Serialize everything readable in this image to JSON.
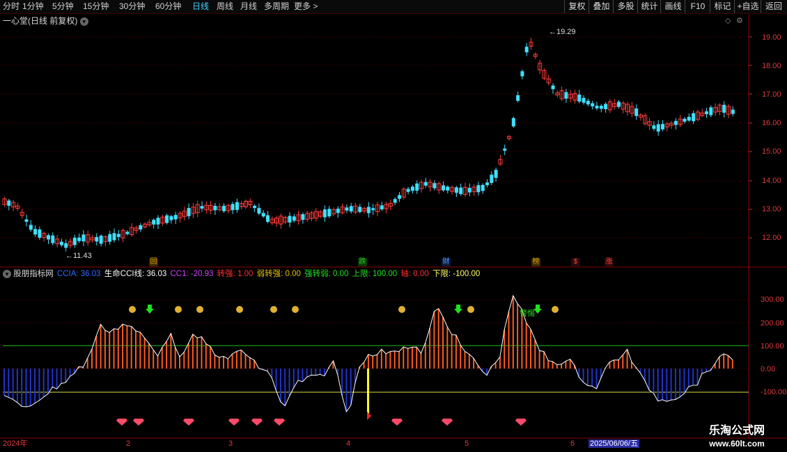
{
  "toolbar": {
    "timeframes": [
      "分时",
      "1分钟",
      "5分钟",
      "15分钟",
      "30分钟",
      "60分钟",
      "日线",
      "周线",
      "月线",
      "多周期",
      "更多 >"
    ],
    "active": "日线",
    "right_buttons": [
      "复权",
      "叠加",
      "多股",
      "统计",
      "画线",
      "F10",
      "标记",
      "+自选",
      "返回"
    ]
  },
  "main_chart": {
    "title": "一心堂(日线 前复权)",
    "high_label": "19.29",
    "low_label": "11.43",
    "y_ticks": [
      "19.00",
      "18.00",
      "17.00",
      "16.00",
      "15.00",
      "14.00",
      "13.00",
      "12.00"
    ],
    "badges": [
      {
        "text": "回",
        "color": "#e0a000"
      },
      {
        "text": "跌",
        "color": "#00c000"
      },
      {
        "text": "财",
        "color": "#3a7aff"
      },
      {
        "text": "榜",
        "color": "#e0a000"
      },
      {
        "text": "$",
        "color": "#ff4040"
      },
      {
        "text": "涨",
        "color": "#ff4040"
      }
    ]
  },
  "indicator": {
    "name": "股朋指标网",
    "items": [
      {
        "label": "CCIA: 36.03",
        "color": "#2f6cff"
      },
      {
        "label": "生命CCI线: 36.03",
        "color": "#ffffff"
      },
      {
        "label": "CC1: -20.93",
        "color": "#d040ff"
      },
      {
        "label": "转强: 1.00",
        "color": "#ff3030"
      },
      {
        "label": "弱转强: 0.00",
        "color": "#e0c000"
      },
      {
        "label": "强转弱: 0.00",
        "color": "#20e020"
      },
      {
        "label": "上限: 100.00",
        "color": "#20e020"
      },
      {
        "label": "轴: 0.00",
        "color": "#ff3030"
      },
      {
        "label": "下限: -100.00",
        "color": "#ffff60"
      }
    ],
    "y_ticks": [
      "300.00",
      "200.00",
      "100.00",
      "0.00",
      "-100.00"
    ],
    "signal_text": "警惕"
  },
  "time_axis": {
    "labels": [
      "2024年",
      "2",
      "3",
      "4",
      "5",
      "6"
    ],
    "current_date": "2025/06/06/五"
  },
  "watermark": {
    "line1": "乐淘公式网",
    "line2": "www.60lt.com"
  },
  "colors": {
    "up": "#ff3c3c",
    "down": "#3fe0ff",
    "cci_pos": "#ff5a1e",
    "cci_neg": "#2233cc",
    "grid": "#6a0000"
  }
}
